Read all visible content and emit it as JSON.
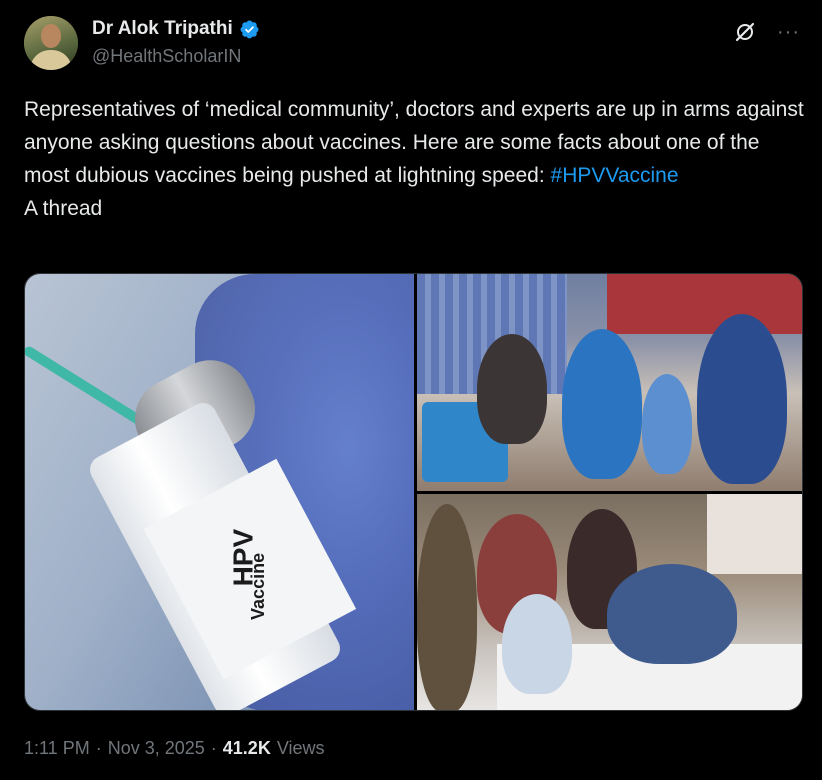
{
  "author": {
    "name": "Dr Alok Tripathi",
    "handle": "@HealthScholarIN",
    "verified": true,
    "verified_color": "#1d9bf0"
  },
  "icons": {
    "grok": "grok-icon",
    "more": "more-icon",
    "more_glyph": "···"
  },
  "post": {
    "text_before_hashtag": "Representatives of ‘medical community’, doctors and experts are up in arms against anyone asking questions about vaccines. Here are some facts about one of the most dubious vaccines being pushed at lightning speed: ",
    "hashtag": "#HPVVaccine",
    "text_after": "A thread"
  },
  "media": {
    "left_label_line1": "HPV",
    "left_label_line2": "Vaccine",
    "count": 3
  },
  "meta": {
    "time": "1:11 PM",
    "date": "Nov 3, 2025",
    "separator": "·",
    "views_count": "41.2K",
    "views_label": "Views"
  },
  "colors": {
    "background": "#000000",
    "text_primary": "#e7e9ea",
    "text_secondary": "#71767b",
    "accent": "#1d9bf0"
  }
}
